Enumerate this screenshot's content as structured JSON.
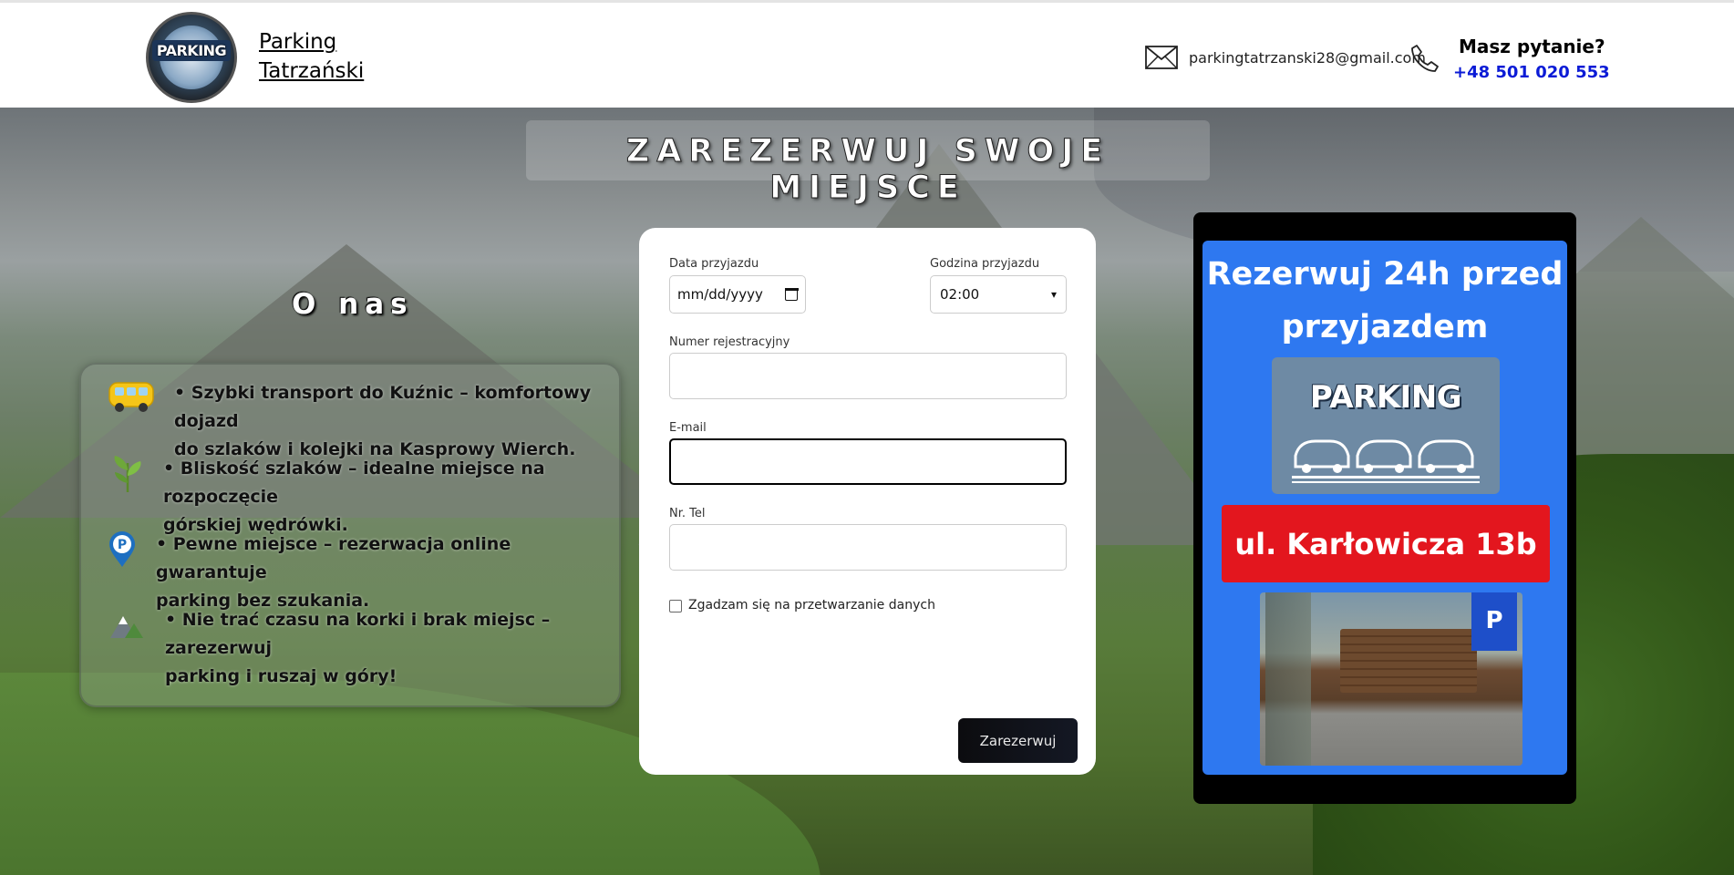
{
  "header": {
    "logo_text": "PARKING",
    "brand_line1": "Parking",
    "brand_line2": "Tatrzański",
    "email": "parkingtatrzanski28@gmail.com",
    "question": "Masz pytanie?",
    "phone": "+48 501 020 553"
  },
  "hero": {
    "title": "ZAREZERWUJ SWOJE MIEJSCE"
  },
  "about": {
    "title": "O nas",
    "items": [
      {
        "icon": "bus-icon",
        "text_line1": "• Szybki transport do Kuźnic – komfortowy dojazd",
        "text_line2": "do szlaków i kolejki na Kasprowy Wierch."
      },
      {
        "icon": "leaf-icon",
        "text_line1": "• Bliskość szlaków – idealne miejsce na rozpoczęcie",
        "text_line2": "górskiej wędrówki."
      },
      {
        "icon": "parking-pin-icon",
        "text_line1": "• Pewne miejsce – rezerwacja online gwarantuje",
        "text_line2": "parking bez szukania."
      },
      {
        "icon": "mountain-icon",
        "text_line1": "• Nie trać czasu na korki i brak miejsc – zarezerwuj",
        "text_line2": "parking i ruszaj w góry!"
      }
    ]
  },
  "form": {
    "date_label": "Data przyjazdu",
    "date_value": "mm/dd/yyyy",
    "time_label": "Godzina przyjazdu",
    "time_value": "02:00",
    "plate_label": "Numer rejestracyjny",
    "plate_value": "",
    "email_label": "E-mail",
    "email_value": "",
    "phone_label": "Nr. Tel",
    "phone_value": "",
    "consent_label": "Zgadzam się na przetwarzanie danych",
    "consent_checked": false,
    "submit_label": "Zarezerwuj"
  },
  "promo": {
    "title_line1": "Rezerwuj 24h przed",
    "title_line2": "przyjazdem",
    "logo_text": "PARKING",
    "address": "ul. Karłowicza 13b",
    "sign_text": "P"
  },
  "colors": {
    "accent_blue": "#2e78f0",
    "address_red": "#e3161e",
    "phone_blue": "#0b1bd6",
    "button_dark": "#0c0c0f"
  }
}
